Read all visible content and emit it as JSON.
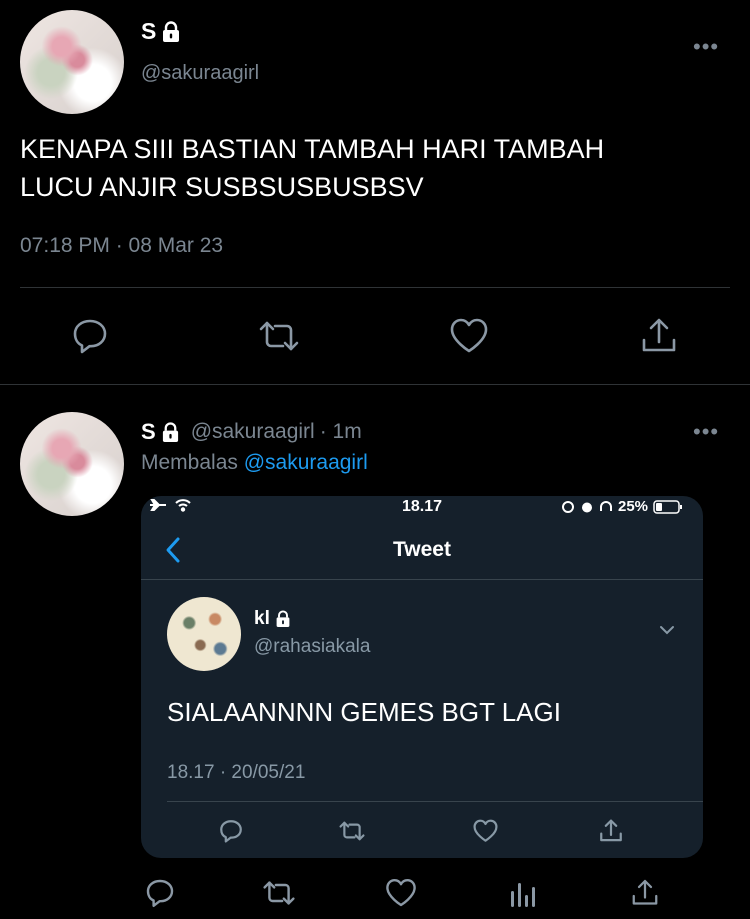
{
  "tweet1": {
    "display_name": "S",
    "handle": "@sakuraagirl",
    "text_line1": "KENAPA SIII BASTIAN TAMBAH HARI TAMBAH",
    "text_line2": "LUCU ANJIR SUSBSUSBUSBSV",
    "timestamp": "07:18 PM · 08 Mar 23",
    "more": "•••"
  },
  "reply": {
    "display_name": "S",
    "handle": "@sakuraagirl",
    "time": "· 1m",
    "replying_prefix": "Membalas",
    "replying_to": "@sakuraagirl",
    "more": "•••"
  },
  "embedded": {
    "status_time": "18.17",
    "battery": "25%",
    "header_title": "Tweet",
    "display_name": "kl",
    "handle": "@rahasiakala",
    "text": "SIALAANNNN GEMES BGT LAGI",
    "timestamp": "18.17 · 20/05/21"
  },
  "colors": {
    "background": "#000000",
    "embed_background": "#15202b",
    "muted": "#7b8691",
    "link": "#1d9bf0",
    "divider": "#2f3336"
  },
  "icons": [
    "lock-icon",
    "reply-icon",
    "retweet-icon",
    "like-icon",
    "share-icon",
    "analytics-icon",
    "back-icon",
    "chevron-down-icon",
    "airplane-icon",
    "wifi-icon",
    "alarm-icon",
    "headphones-icon",
    "battery-icon"
  ]
}
